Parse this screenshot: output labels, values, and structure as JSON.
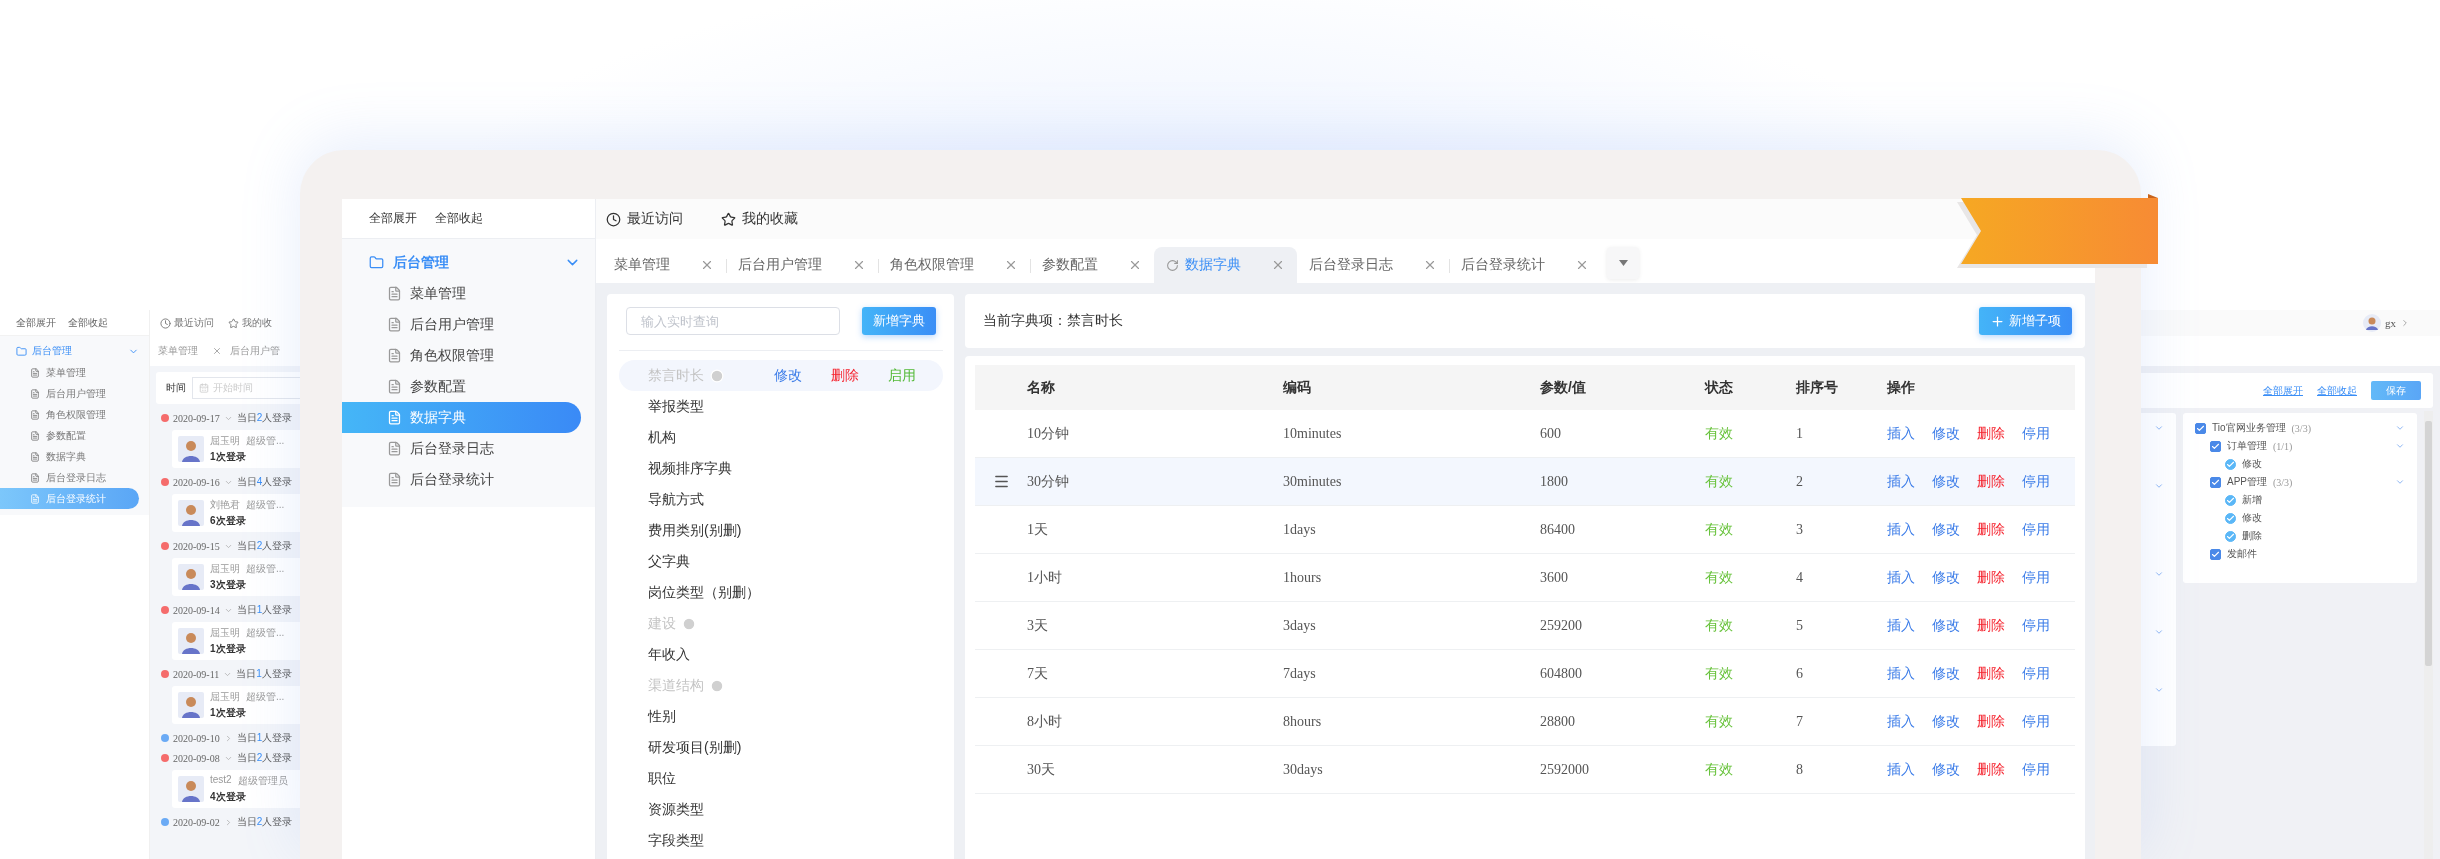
{
  "background_left": {
    "toolbar": [
      "全部展开",
      "全部收起"
    ],
    "tree": {
      "label": "后台管理",
      "expanded": true,
      "children": [
        {
          "label": "菜单管理",
          "selected": false
        },
        {
          "label": "后台用户管理",
          "selected": false
        },
        {
          "label": "角色权限管理",
          "selected": false
        },
        {
          "label": "参数配置",
          "selected": false
        },
        {
          "label": "数据字典",
          "selected": false
        },
        {
          "label": "后台登录日志",
          "selected": false
        },
        {
          "label": "后台登录统计",
          "selected": true
        }
      ]
    },
    "topbar": [
      {
        "kind": "recent",
        "label": "最近访问"
      },
      {
        "kind": "favorite",
        "label": "我的收"
      }
    ],
    "tabs": [
      {
        "label": "菜单管理",
        "closable": true
      },
      {
        "label": "后台用户管",
        "closable": false
      }
    ],
    "filter": {
      "label": "时间",
      "placeholder": "开始时间"
    },
    "timeline": [
      {
        "date": "2020-09-17",
        "expanded": true,
        "color": "#f56c6c",
        "summary": {
          "prefix": "当日",
          "count": "2",
          "suffix": "人登录"
        },
        "card": {
          "name": "屈玉明",
          "role": "超级管...",
          "logins": "1次登录"
        }
      },
      {
        "date": "2020-09-16",
        "expanded": true,
        "color": "#f56c6c",
        "summary": {
          "prefix": "当日",
          "count": "4",
          "suffix": "人登录"
        },
        "card": {
          "name": "刘艳君",
          "role": "超级管...",
          "logins": "6次登录"
        }
      },
      {
        "date": "2020-09-15",
        "expanded": true,
        "color": "#f56c6c",
        "summary": {
          "prefix": "当日",
          "count": "2",
          "suffix": "人登录"
        },
        "card": {
          "name": "屈玉明",
          "role": "超级管...",
          "logins": "3次登录"
        }
      },
      {
        "date": "2020-09-14",
        "expanded": true,
        "color": "#f56c6c",
        "summary": {
          "prefix": "当日",
          "count": "1",
          "suffix": "人登录"
        },
        "card": {
          "name": "屈玉明",
          "role": "超级管...",
          "logins": "1次登录"
        }
      },
      {
        "date": "2020-09-11",
        "expanded": true,
        "color": "#f56c6c",
        "summary": {
          "prefix": "当日",
          "count": "1",
          "suffix": "人登录"
        },
        "card": {
          "name": "屈玉明",
          "role": "超级管...",
          "logins": "1次登录"
        }
      },
      {
        "date": "2020-09-10",
        "expanded": false,
        "color": "#6aaaf5",
        "summary": {
          "prefix": "当日",
          "count": "1",
          "suffix": "人登录"
        }
      },
      {
        "date": "2020-09-08",
        "expanded": true,
        "color": "#f56c6c",
        "summary": {
          "prefix": "当日",
          "count": "2",
          "suffix": "人登录"
        },
        "card": {
          "name": "test2",
          "role": "超级管理员",
          "logins": "4次登录"
        }
      },
      {
        "date": "2020-09-02",
        "expanded": false,
        "color": "#6aaaf5",
        "summary": {
          "prefix": "当日",
          "count": "2",
          "suffix": "人登录"
        }
      }
    ]
  },
  "main": {
    "sidebar": {
      "toolbar": [
        "全部展开",
        "全部收起"
      ],
      "tree": {
        "label": "后台管理",
        "expanded": true,
        "children": [
          {
            "label": "菜单管理",
            "selected": false
          },
          {
            "label": "后台用户管理",
            "selected": false
          },
          {
            "label": "角色权限管理",
            "selected": false
          },
          {
            "label": "参数配置",
            "selected": false
          },
          {
            "label": "数据字典",
            "selected": true
          },
          {
            "label": "后台登录日志",
            "selected": false
          },
          {
            "label": "后台登录统计",
            "selected": false
          }
        ]
      }
    },
    "topbar": [
      {
        "kind": "recent",
        "label": "最近访问"
      },
      {
        "kind": "favorite",
        "label": "我的收藏"
      }
    ],
    "tabs": [
      {
        "label": "菜单管理",
        "selected": false
      },
      {
        "label": "后台用户管理",
        "selected": false
      },
      {
        "label": "角色权限管理",
        "selected": false
      },
      {
        "label": "参数配置",
        "selected": false
      },
      {
        "label": "数据字典",
        "selected": true
      },
      {
        "label": "后台登录日志",
        "selected": false
      },
      {
        "label": "后台登录统计",
        "selected": false
      }
    ],
    "dictionary": {
      "search": {
        "placeholder": "输入实时查询"
      },
      "add_button": "新增字典",
      "items": [
        {
          "label": "禁言时长",
          "selected": true,
          "disabled": true,
          "actions": [
            {
              "kind": "edit",
              "label": "修改"
            },
            {
              "kind": "delete",
              "label": "删除"
            },
            {
              "kind": "enable",
              "label": "启用"
            }
          ]
        },
        {
          "label": "举报类型",
          "selected": false,
          "disabled": false
        },
        {
          "label": "机构",
          "selected": false,
          "disabled": false
        },
        {
          "label": "视频排序字典",
          "selected": false,
          "disabled": false
        },
        {
          "label": "导航方式",
          "selected": false,
          "disabled": false
        },
        {
          "label": "费用类别(别删)",
          "selected": false,
          "disabled": false
        },
        {
          "label": "父字典",
          "selected": false,
          "disabled": false
        },
        {
          "label": "岗位类型（别删）",
          "selected": false,
          "disabled": false
        },
        {
          "label": "建设",
          "selected": false,
          "disabled": true
        },
        {
          "label": "年收入",
          "selected": false,
          "disabled": false
        },
        {
          "label": "渠道结构",
          "selected": false,
          "disabled": true
        },
        {
          "label": "性别",
          "selected": false,
          "disabled": false
        },
        {
          "label": "研发项目(别删)",
          "selected": false,
          "disabled": false
        },
        {
          "label": "职位",
          "selected": false,
          "disabled": false
        },
        {
          "label": "资源类型",
          "selected": false,
          "disabled": false
        },
        {
          "label": "字段类型",
          "selected": false,
          "disabled": false
        }
      ]
    },
    "detail": {
      "current": "当前字典项：禁言时长",
      "add_button": "新增子项"
    },
    "table": {
      "columns": [
        "名称",
        "编码",
        "参数/值",
        "状态",
        "排序号",
        "操作"
      ],
      "rows": [
        {
          "name": "10分钟",
          "code": "10minutes",
          "value": "600",
          "status": "有效",
          "status_active": true,
          "order": "1",
          "selected": false,
          "actions": [
            {
              "kind": "insert",
              "label": "插入"
            },
            {
              "kind": "edit",
              "label": "修改"
            },
            {
              "kind": "delete",
              "label": "删除"
            },
            {
              "kind": "disable",
              "label": "停用"
            }
          ]
        },
        {
          "name": "30分钟",
          "code": "30minutes",
          "value": "1800",
          "status": "有效",
          "status_active": true,
          "order": "2",
          "selected": true,
          "actions": [
            {
              "kind": "insert",
              "label": "插入"
            },
            {
              "kind": "edit",
              "label": "修改"
            },
            {
              "kind": "delete",
              "label": "删除"
            },
            {
              "kind": "disable",
              "label": "停用"
            }
          ]
        },
        {
          "name": "1天",
          "code": "1days",
          "value": "86400",
          "status": "有效",
          "status_active": true,
          "order": "3",
          "selected": false,
          "actions": [
            {
              "kind": "insert",
              "label": "插入"
            },
            {
              "kind": "edit",
              "label": "修改"
            },
            {
              "kind": "delete",
              "label": "删除"
            },
            {
              "kind": "disable",
              "label": "停用"
            }
          ]
        },
        {
          "name": "1小时",
          "code": "1hours",
          "value": "3600",
          "status": "有效",
          "status_active": true,
          "order": "4",
          "selected": false,
          "actions": [
            {
              "kind": "insert",
              "label": "插入"
            },
            {
              "kind": "edit",
              "label": "修改"
            },
            {
              "kind": "delete",
              "label": "删除"
            },
            {
              "kind": "disable",
              "label": "停用"
            }
          ]
        },
        {
          "name": "3天",
          "code": "3days",
          "value": "259200",
          "status": "有效",
          "status_active": true,
          "order": "5",
          "selected": false,
          "actions": [
            {
              "kind": "insert",
              "label": "插入"
            },
            {
              "kind": "edit",
              "label": "修改"
            },
            {
              "kind": "delete",
              "label": "删除"
            },
            {
              "kind": "disable",
              "label": "停用"
            }
          ]
        },
        {
          "name": "7天",
          "code": "7days",
          "value": "604800",
          "status": "有效",
          "status_active": true,
          "order": "6",
          "selected": false,
          "actions": [
            {
              "kind": "insert",
              "label": "插入"
            },
            {
              "kind": "edit",
              "label": "修改"
            },
            {
              "kind": "delete",
              "label": "删除"
            },
            {
              "kind": "disable",
              "label": "停用"
            }
          ]
        },
        {
          "name": "8小时",
          "code": "8hours",
          "value": "28800",
          "status": "有效",
          "status_active": true,
          "order": "7",
          "selected": false,
          "actions": [
            {
              "kind": "insert",
              "label": "插入"
            },
            {
              "kind": "edit",
              "label": "修改"
            },
            {
              "kind": "delete",
              "label": "删除"
            },
            {
              "kind": "disable",
              "label": "停用"
            }
          ]
        },
        {
          "name": "30天",
          "code": "30days",
          "value": "2592000",
          "status": "有效",
          "status_active": true,
          "order": "8",
          "selected": false,
          "actions": [
            {
              "kind": "insert",
              "label": "插入"
            },
            {
              "kind": "edit",
              "label": "修改"
            },
            {
              "kind": "delete",
              "label": "删除"
            },
            {
              "kind": "disable",
              "label": "停用"
            }
          ]
        }
      ]
    }
  },
  "background_right": {
    "user": {
      "name": "gx"
    },
    "links": [
      "全部展开",
      "全部收起"
    ],
    "save_button": "保存",
    "tree": [
      {
        "kind": "menu",
        "label": "Tio官网业务管理",
        "count": "(3/3)",
        "checked": true,
        "expanded": true,
        "children": [
          {
            "kind": "menu",
            "label": "订单管理",
            "count": "(1/1)",
            "checked": true,
            "expanded": true,
            "children": [
              {
                "kind": "action",
                "label": "修改",
                "checked": true
              }
            ]
          },
          {
            "kind": "menu",
            "label": "APP管理",
            "count": "(3/3)",
            "checked": true,
            "expanded": true,
            "children": [
              {
                "kind": "action",
                "label": "新增",
                "checked": true
              },
              {
                "kind": "action",
                "label": "修改",
                "checked": true
              },
              {
                "kind": "action",
                "label": "删除",
                "checked": true
              }
            ]
          },
          {
            "kind": "menu",
            "label": "发邮件",
            "checked": true
          }
        ]
      }
    ]
  }
}
